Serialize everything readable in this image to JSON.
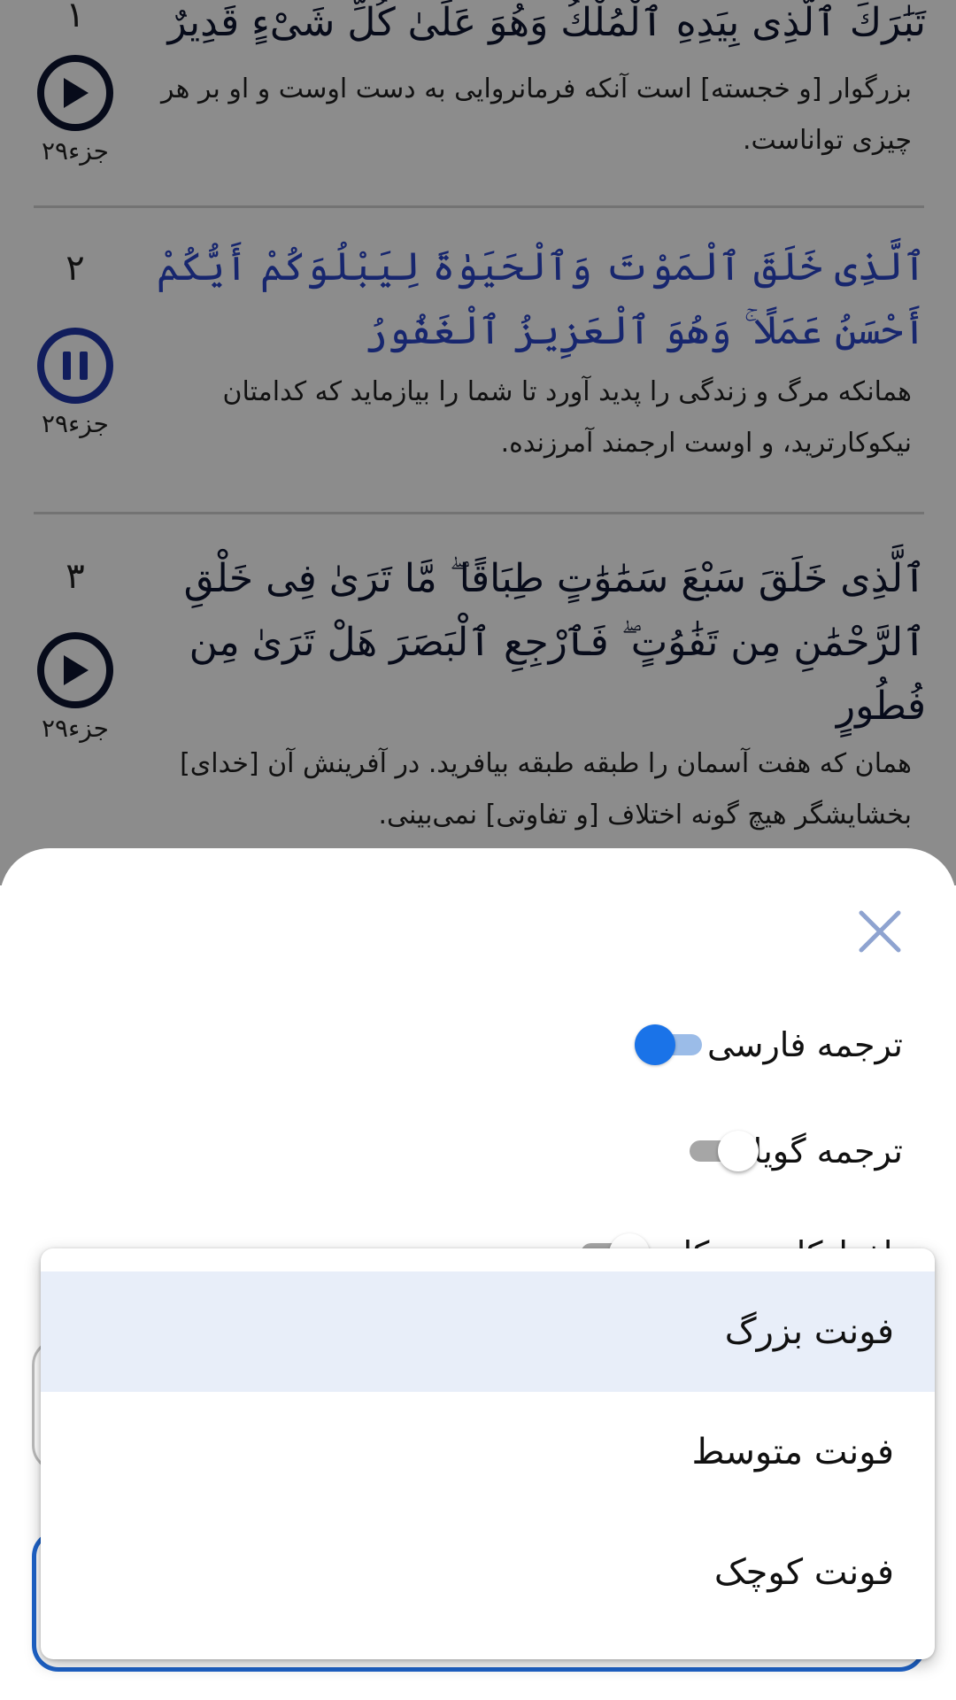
{
  "verses": [
    {
      "number": "١",
      "arabic": "تَبَٰرَكَ ٱلَّذِى بِيَدِهِ ٱلْمُلْكُ وَهُوَ عَلَىٰ كُلِّ شَىْءٍ قَدِيرٌ",
      "translation": "بزرگوار [و خجسته] است آنکه فرمانروایی به دست اوست و او بر هر چیزی تواناست.",
      "juz": "جزء۲۹",
      "state": "play"
    },
    {
      "number": "٢",
      "arabic": "ٱلَّذِى خَلَقَ ٱلْمَوْتَ وَٱلْحَيَوٰةَ لِيَبْلُوَكُمْ أَيُّكُمْ أَحْسَنُ عَمَلًا ۚ وَهُوَ ٱلْعَزِيزُ ٱلْغَفُورُ",
      "translation": "همانکه مرگ و زندگی را پدید آورد تا شما را بیازماید که کدامتان نیکوکارترید، و اوست ارجمند آمرزنده.",
      "juz": "جزء۲۹",
      "state": "pause"
    },
    {
      "number": "٣",
      "arabic": "ٱلَّذِى خَلَقَ سَبْعَ سَمَٰوَٰتٍ طِبَاقًا ۖ مَّا تَرَىٰ فِى خَلْقِ ٱلرَّحْمَٰنِ مِن تَفَٰوُتٍ ۖ فَٱرْجِعِ ٱلْبَصَرَ هَلْ تَرَىٰ مِن فُطُورٍ",
      "translation": "همان که هفت آسمان را طبقه طبقه بیافرید. در آفرینش آن [خدای] بخشایشگر هیچ گونه اختلاف [و تفاوتی] نمی‌بینی.",
      "juz": "جزء۲۹",
      "state": "play"
    }
  ],
  "sheet": {
    "toggles": [
      {
        "label": "ترجمه فارسی",
        "on": true
      },
      {
        "label": "ترجمه گویا",
        "on": false
      },
      {
        "label": "تلفظ کلمه به کلمه",
        "on": false
      }
    ]
  },
  "font_menu": {
    "selected_index": 0,
    "options": [
      "فونت بزرگ",
      "فونت متوسط",
      "فونت کوچک"
    ]
  },
  "colors": {
    "accent": "#1a73e8",
    "active_verse": "#2a46c9",
    "menu_highlight": "#e8eef9",
    "field_focus": "#1e63c9"
  },
  "icons": {
    "play": "play-circle-icon",
    "pause": "pause-circle-icon",
    "close": "close-icon"
  }
}
